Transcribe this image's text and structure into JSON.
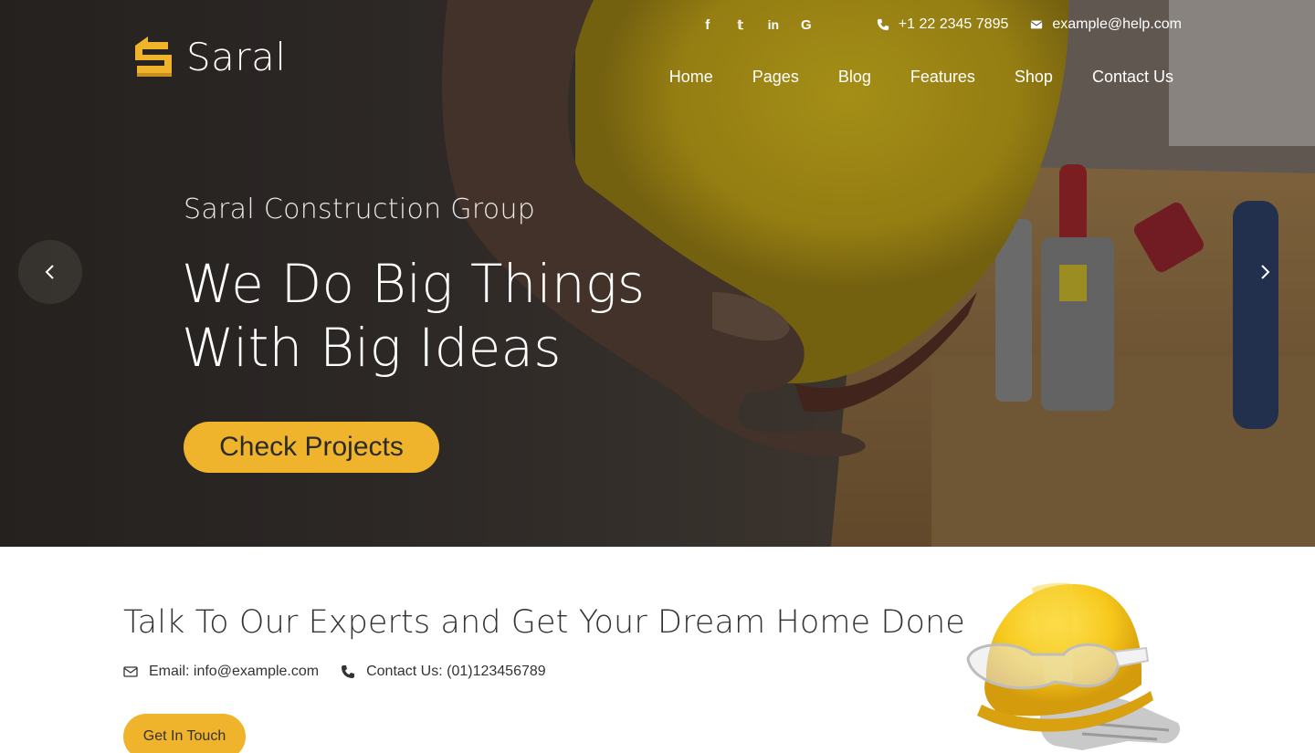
{
  "brand": {
    "name": "Saral",
    "accent_color": "#f0b42c"
  },
  "topbar": {
    "social": [
      {
        "icon": "facebook-icon",
        "glyph": "f"
      },
      {
        "icon": "twitter-icon",
        "glyph": "t"
      },
      {
        "icon": "linkedin-icon",
        "glyph": "in"
      },
      {
        "icon": "google-icon",
        "glyph": "G"
      }
    ],
    "phone": "+1 22 2345 7895",
    "email": "example@help.com"
  },
  "nav": {
    "items": [
      "Home",
      "Pages",
      "Blog",
      "Features",
      "Shop",
      "Contact Us"
    ]
  },
  "hero": {
    "subtitle": "Saral Construction Group",
    "title_line1": "We Do Big Things",
    "title_line2": "With Big Ideas",
    "button_label": "Check Projects"
  },
  "cta": {
    "title": "Talk To Our Experts and Get Your Dream Home Done",
    "email_text": "Email: info@example.com",
    "contact_text": "Contact Us: (01)123456789",
    "button_label": "Get In Touch"
  }
}
